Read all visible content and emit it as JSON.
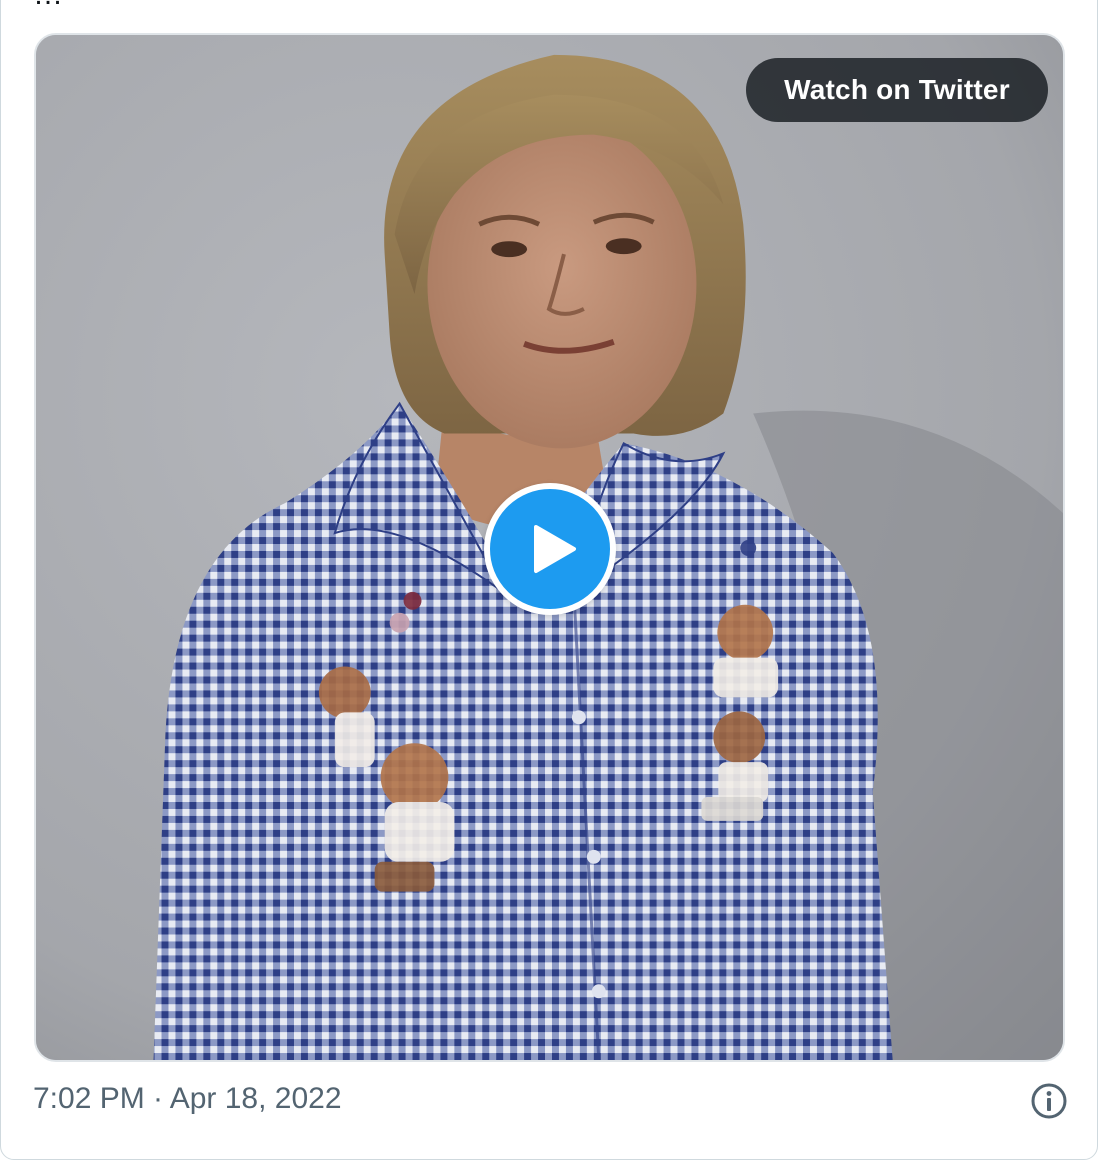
{
  "tweet": {
    "clipped_text": "…",
    "media": {
      "watch_label": "Watch on Twitter",
      "play_icon": "play-icon"
    },
    "footer": {
      "timestamp": "7:02 PM · Apr 18, 2022",
      "info_icon": "info-icon"
    }
  },
  "colors": {
    "play_blue": "#1d9bf0",
    "timestamp_gray": "#536471",
    "border_gray": "#cfd9de",
    "watch_bg": "#0f1419"
  }
}
